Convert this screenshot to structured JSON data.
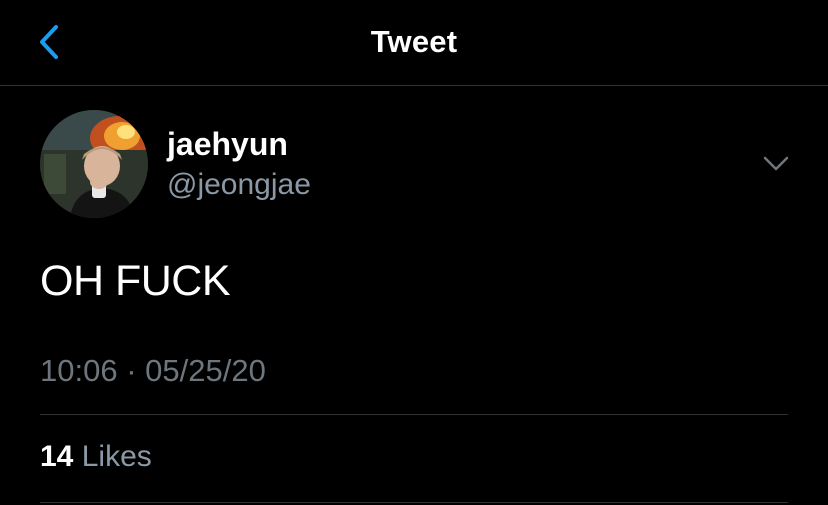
{
  "header": {
    "title": "Tweet",
    "back_icon": "chevron-left-icon",
    "accent_color": "#1d9bf0"
  },
  "author": {
    "display_name": "jaehyun",
    "handle": "@jeongjae",
    "avatar_icon": "avatar"
  },
  "tweet": {
    "text": "OH FUCK",
    "time": "10:06",
    "separator": "·",
    "date": "05/25/20",
    "more_icon": "chevron-down-icon"
  },
  "stats": {
    "likes_count": "14",
    "likes_label": "Likes"
  },
  "colors": {
    "background": "#000000",
    "primary_text": "#ffffff",
    "secondary_text": "#8b98a5",
    "divider": "#2f3336"
  }
}
